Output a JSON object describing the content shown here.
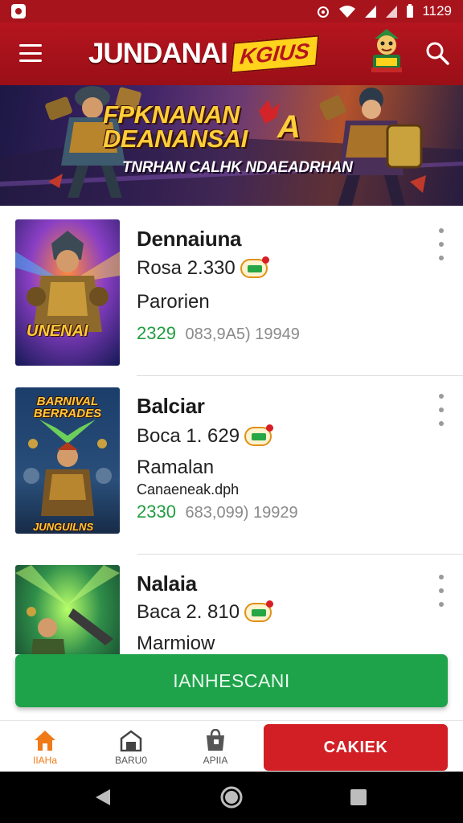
{
  "status_bar": {
    "time": "1129"
  },
  "app_bar": {
    "brand_main": "JUNDANAI",
    "brand_badge": "KGIUS"
  },
  "banner": {
    "title_line1": "FPKNANAN",
    "title_line2": "DEANANSAI",
    "badge": "A",
    "subtitle": "TNRHAN CALHK NDAEADRHAN"
  },
  "items": [
    {
      "thumb_text": "UNENAI",
      "title": "Dennaiuna",
      "price": "Rosa 2.330",
      "subtitle": "Parorien",
      "extra": "",
      "stat_green": "2329",
      "stat_grey": "083,9A5) 19949"
    },
    {
      "thumb_text_top": "BARNIVAL BERRADES",
      "thumb_text": "JUNGUILNS",
      "title": "Balciar",
      "price": "Boca 1. 629",
      "subtitle": "Ramalan",
      "extra": "Canaeneak.dph",
      "stat_green": "2330",
      "stat_grey": "683,099) 19929"
    },
    {
      "title": "Nalaia",
      "price": "Baca 2. 810",
      "subtitle": "Marmiow"
    }
  ],
  "cta": {
    "label": "IANHESCANI"
  },
  "bottom_nav": {
    "tabs": [
      {
        "label": "IIAHa"
      },
      {
        "label": "BARU0"
      },
      {
        "label": "APIIA"
      }
    ],
    "checkout_label": "CAKIEK"
  },
  "colors": {
    "brand_red": "#b5151e",
    "cta_green": "#1ea34a",
    "checkout_red": "#d11f25",
    "active_orange": "#f07a17",
    "stat_green": "#1f9d3f"
  }
}
